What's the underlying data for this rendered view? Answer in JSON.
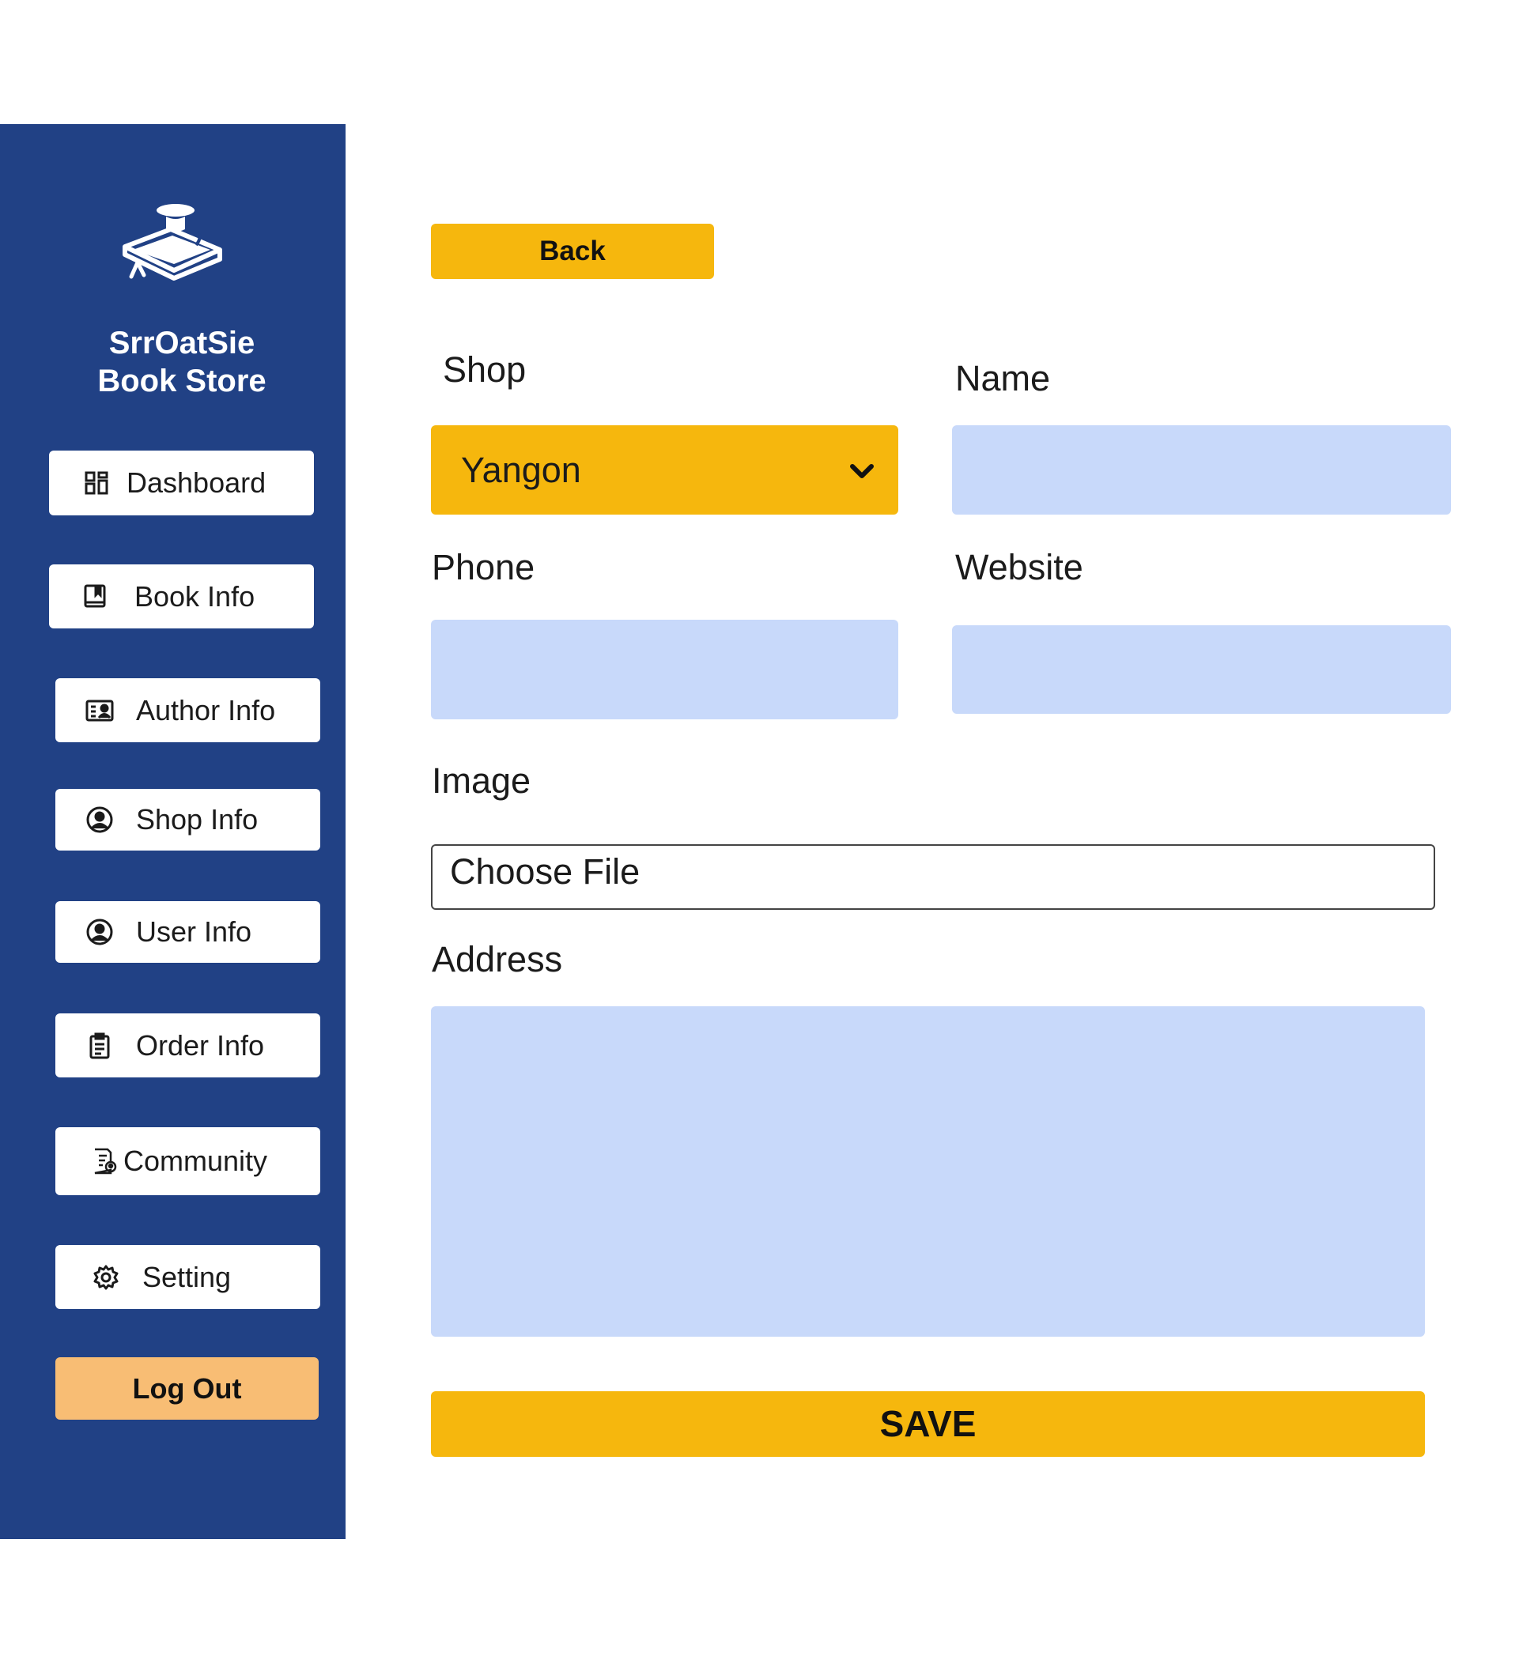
{
  "brand": {
    "line1": "SrrOatSie",
    "line2": "Book Store",
    "logo_icon": "book-with-graduation-cap-icon"
  },
  "sidebar": {
    "items": [
      {
        "label": "Dashboard",
        "icon": "dashboard-grid-icon"
      },
      {
        "label": "Book Info",
        "icon": "book-icon"
      },
      {
        "label": "Author Info",
        "icon": "id-card-icon"
      },
      {
        "label": "Shop Info",
        "icon": "user-circle-icon"
      },
      {
        "label": "User Info",
        "icon": "user-circle-icon"
      },
      {
        "label": "Order Info",
        "icon": "clipboard-icon"
      },
      {
        "label": "Community",
        "icon": "document-user-icon"
      },
      {
        "label": "Setting",
        "icon": "gear-icon"
      }
    ],
    "logout_label": "Log Out"
  },
  "form": {
    "back_label": "Back",
    "shop_label": "Shop",
    "shop_value": "Yangon",
    "name_label": "Name",
    "name_value": "",
    "phone_label": "Phone",
    "phone_value": "",
    "website_label": "Website",
    "website_value": "",
    "image_label": "Image",
    "file_button": "Choose File",
    "address_label": "Address",
    "address_value": "",
    "save_label": "SAVE"
  },
  "colors": {
    "sidebar_bg": "#214185",
    "accent_yellow": "#f6b70d",
    "logout_orange": "#f8bd74",
    "input_blue": "#c8d9fa"
  }
}
